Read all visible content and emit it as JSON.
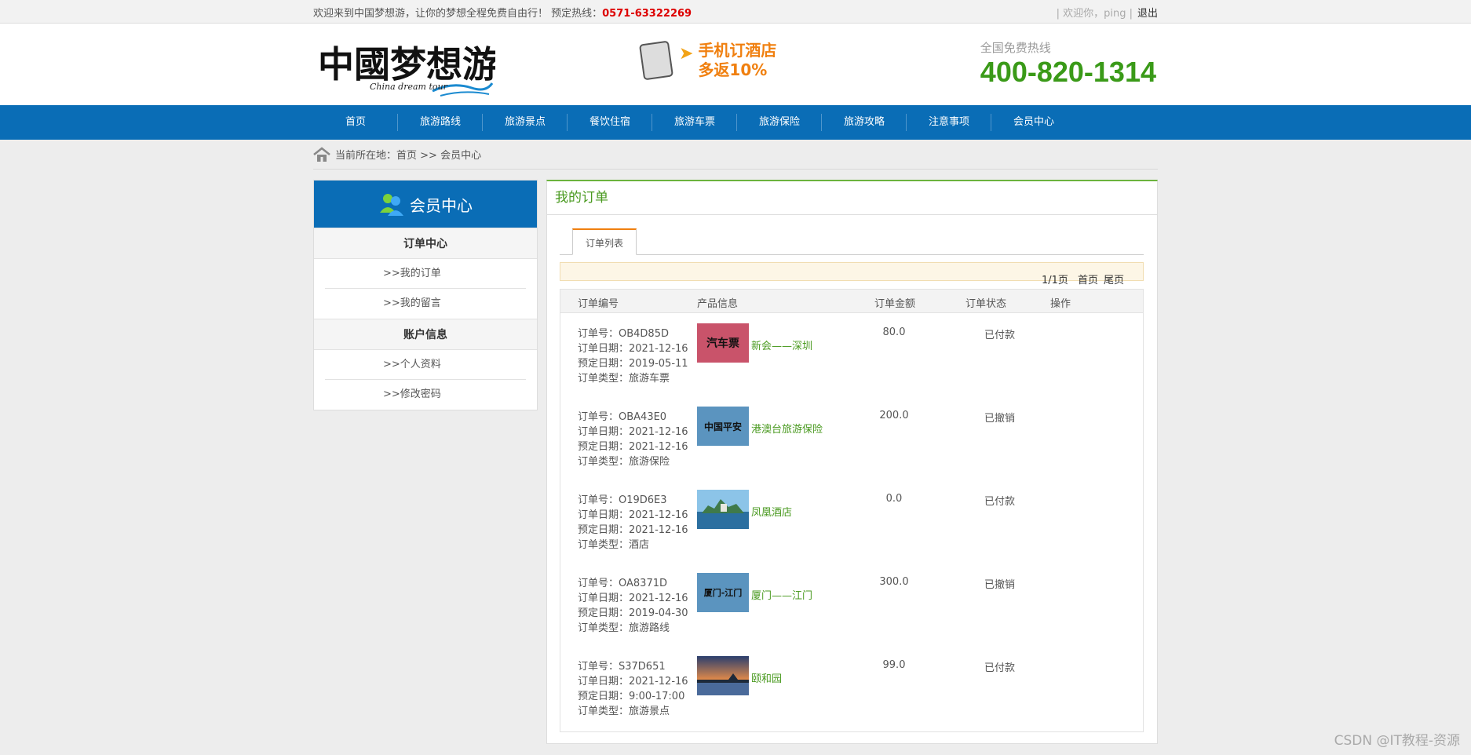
{
  "topbar": {
    "welcome": "欢迎来到中国梦想游，让你的梦想全程免费自由行！ 预定热线：",
    "hotline": "0571-63322269",
    "greeting": "| 欢迎你，ping |",
    "logout": "退出"
  },
  "header": {
    "logo_text": "中國梦想游",
    "logo_sub": "China dream tour",
    "promo_line1": "手机订酒店",
    "promo_line2": "多返10%",
    "hotline_label": "全国免费热线",
    "hotline_number": "400-820-1314"
  },
  "nav": [
    "首页",
    "旅游路线",
    "旅游景点",
    "餐饮住宿",
    "旅游车票",
    "旅游保险",
    "旅游攻略",
    "注意事项",
    "会员中心"
  ],
  "breadcrumb": {
    "label": "当前所在地：",
    "path": "首页 >> 会员中心"
  },
  "sidebar": {
    "title": "会员中心",
    "sections": [
      {
        "title": "订单中心",
        "links": [
          ">>我的订单",
          ">>我的留言"
        ]
      },
      {
        "title": "账户信息",
        "links": [
          ">>个人资料",
          ">>修改密码"
        ]
      }
    ]
  },
  "main": {
    "title": "我的订单",
    "tab": "订单列表",
    "pager": {
      "page": "1/1页",
      "first": "首页",
      "last": "尾页"
    },
    "columns": [
      "订单编号",
      "产品信息",
      "订单金额",
      "订单状态",
      "操作"
    ],
    "orders": [
      {
        "no": "订单号：OB4D85D",
        "date": "订单日期：2021-12-16",
        "book": "预定日期：2019-05-11",
        "type": "订单类型：旅游车票",
        "thumb_text": "汽车票",
        "product": "新会——深圳",
        "amount": "80.0",
        "status": "已付款",
        "thumb": "ticket"
      },
      {
        "no": "订单号：OBA43E0",
        "date": "订单日期：2021-12-16",
        "book": "预定日期：2021-12-16",
        "type": "订单类型：旅游保险",
        "thumb_text": "中国平安",
        "product": "港澳台旅游保险",
        "amount": "200.0",
        "status": "已撤销",
        "thumb": "insurance"
      },
      {
        "no": "订单号：O19D6E3",
        "date": "订单日期：2021-12-16",
        "book": "预定日期：2021-12-16",
        "type": "订单类型：酒店",
        "thumb_text": "",
        "product": "凤凰酒店",
        "amount": "0.0",
        "status": "已付款",
        "thumb": "hotel"
      },
      {
        "no": "订单号：OA8371D",
        "date": "订单日期：2021-12-16",
        "book": "预定日期：2019-04-30",
        "type": "订单类型：旅游路线",
        "thumb_text": "厦门-江门",
        "product": "厦门——江门",
        "amount": "300.0",
        "status": "已撤销",
        "thumb": "route"
      },
      {
        "no": "订单号：S37D651",
        "date": "订单日期：2021-12-16",
        "book": "预定日期：9:00-17:00",
        "type": "订单类型：旅游景点",
        "thumb_text": "",
        "product": "颐和园",
        "amount": "99.0",
        "status": "已付款",
        "thumb": "park"
      }
    ]
  },
  "watermark": "CSDN @IT教程-资源",
  "colors": {
    "nav_blue": "#0a6db6",
    "accent_green": "#4a9a20",
    "hotline_red": "#dd0000",
    "promo_orange": "#f08010"
  }
}
